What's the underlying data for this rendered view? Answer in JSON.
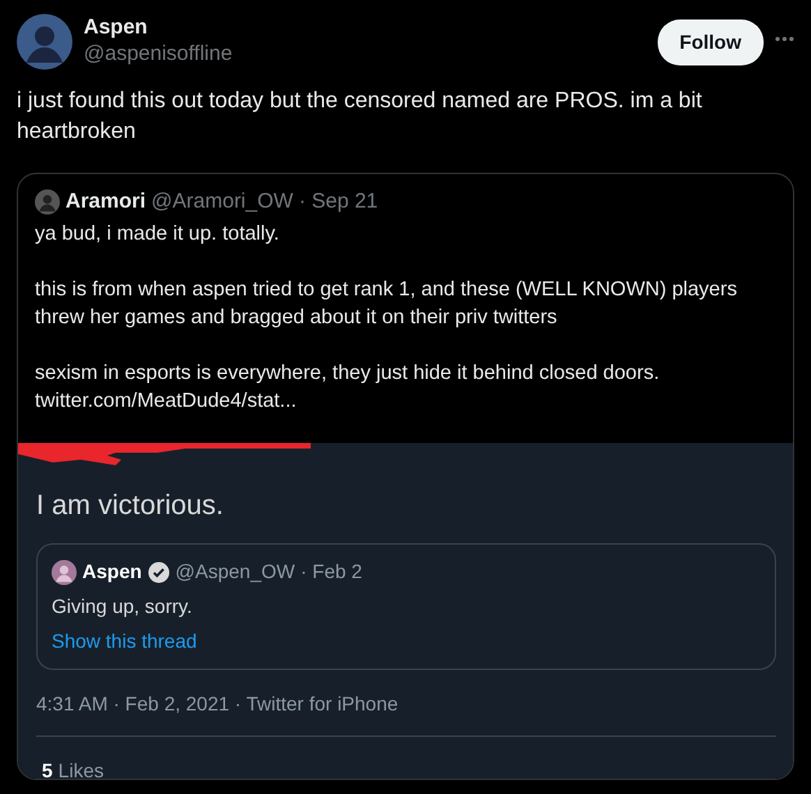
{
  "author": {
    "name": "Aspen",
    "handle": "@aspenisoffline"
  },
  "follow_button": "Follow",
  "text": "i just found this out today but the censored named are PROS. im a bit heartbroken",
  "quoted_tweet": {
    "name": "Aramori",
    "handle": "@Aramori_OW",
    "date": "· Sep 21",
    "paragraphs": [
      "ya bud, i made it up. totally.",
      "this is from when aspen tried to get rank 1, and these (WELL KNOWN) players threw her games and bragged about it on their priv twitters",
      "sexism in esports is everywhere, they just hide it behind closed doors."
    ],
    "link": "twitter.com/MeatDude4/stat...",
    "screenshot": {
      "text": "I am victorious.",
      "quoted_tweet": {
        "name": "Aspen",
        "verified": true,
        "handle": "@Aspen_OW",
        "date": "· Feb 2",
        "text": "Giving up, sorry.",
        "thread_link": "Show this thread"
      },
      "meta": "4:31 AM · Feb 2, 2021 · Twitter for iPhone",
      "likes": {
        "count": "5",
        "label": "Likes"
      }
    }
  }
}
